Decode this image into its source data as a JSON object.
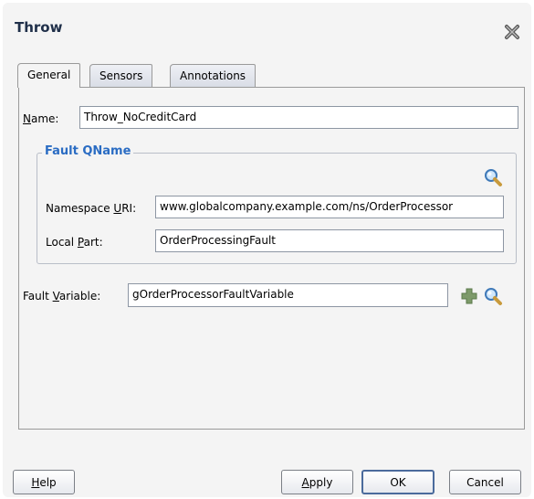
{
  "dialog": {
    "title": "Throw",
    "close_icon": "close-x-icon"
  },
  "tabs": [
    {
      "label": "General",
      "active": true
    },
    {
      "label": "Sensors",
      "active": false
    },
    {
      "label": "Annotations",
      "active": false
    }
  ],
  "name": {
    "label_prefix": "N",
    "label_rest": "ame:",
    "value": "Throw_NoCreditCard"
  },
  "fault_qname": {
    "title": "Fault QName",
    "search_icon": "magnifier-icon",
    "namespace_label_prefix": "Namespace ",
    "namespace_label_mnemonic": "U",
    "namespace_label_suffix": "RI:",
    "namespace_value": "www.globalcompany.example.com/ns/OrderProcessor",
    "local_label_prefix": "Local ",
    "local_label_mnemonic": "P",
    "local_label_suffix": "art:",
    "local_value": "OrderProcessingFault"
  },
  "fault_variable": {
    "label_prefix": "Fault ",
    "label_mnemonic": "V",
    "label_suffix": "ariable:",
    "value": "gOrderProcessorFaultVariable",
    "add_icon": "plus-icon",
    "search_icon": "magnifier-icon"
  },
  "buttons": {
    "help_mnemonic": "H",
    "help_rest": "elp",
    "apply_mnemonic": "A",
    "apply_rest": "pply",
    "ok": "OK",
    "cancel": "Cancel"
  },
  "colors": {
    "group_title": "#2a6cc3",
    "plus_icon": "#7d9a6a"
  }
}
